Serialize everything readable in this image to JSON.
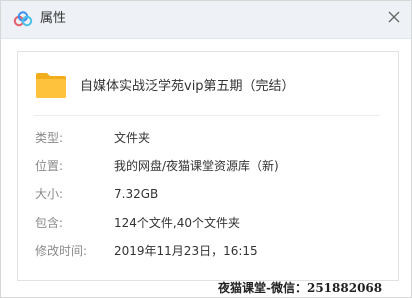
{
  "window": {
    "title": "属性"
  },
  "file": {
    "name": "自媒体实战泛学苑vip第五期（完结）"
  },
  "properties": [
    {
      "label": "类型:",
      "value": "文件夹"
    },
    {
      "label": "位置:",
      "value": "我的网盘/夜猫课堂资源库（新)"
    },
    {
      "label": "大小:",
      "value": "7.32GB"
    },
    {
      "label": "包含:",
      "value": "124个文件,40个文件夹"
    },
    {
      "label": "修改时间:",
      "value": "2019年11月23日，16:15"
    }
  ],
  "watermark": "夜猫课堂-微信：251882068",
  "colors": {
    "titlebar_bg": "#eef1f6",
    "folder_yellow": "#ffc23d",
    "label_gray": "#8a8a8a",
    "value_dark": "#333333"
  },
  "icons": {
    "app": "cloud-logo-icon",
    "close": "close-icon",
    "folder": "folder-icon"
  }
}
